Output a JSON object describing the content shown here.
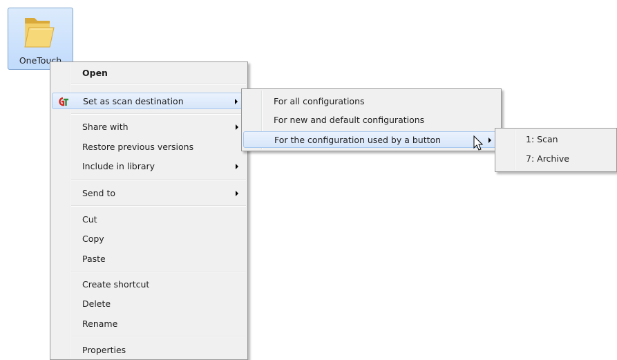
{
  "desktop": {
    "icon_label": "OneTouch",
    "icon_name": "folder-icon"
  },
  "context_menu": {
    "items": [
      {
        "label": "Open",
        "bold": true
      },
      {
        "label": "Set as scan destination",
        "has_submenu": true,
        "icon": "onetouch-app-icon"
      },
      {
        "label": "Share with",
        "has_submenu": true
      },
      {
        "label": "Restore previous versions"
      },
      {
        "label": "Include in library",
        "has_submenu": true
      },
      {
        "label": "Send to",
        "has_submenu": true
      },
      {
        "label": "Cut"
      },
      {
        "label": "Copy"
      },
      {
        "label": "Paste"
      },
      {
        "label": "Create shortcut"
      },
      {
        "label": "Delete"
      },
      {
        "label": "Rename"
      },
      {
        "label": "Properties"
      }
    ]
  },
  "scan_submenu": {
    "items": [
      {
        "label": "For all configurations"
      },
      {
        "label": "For new and default configurations"
      },
      {
        "label": "For the configuration used by a button",
        "has_submenu": true
      }
    ]
  },
  "button_submenu": {
    "items": [
      {
        "label": "1: Scan"
      },
      {
        "label": "7: Archive"
      }
    ]
  },
  "colors": {
    "menu_background": "#f0f0f0",
    "menu_border": "#979797",
    "highlight": "#d7e6fa",
    "highlight_border": "#a8c8ee",
    "folder": "#f0c75a"
  }
}
